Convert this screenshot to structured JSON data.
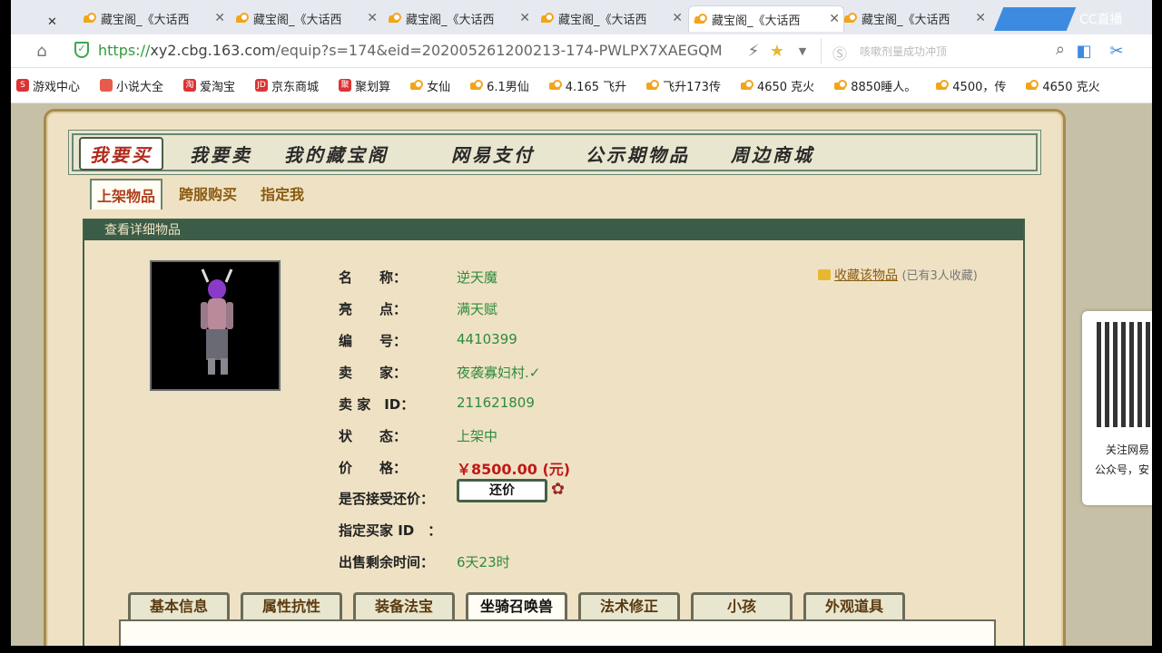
{
  "browser": {
    "tabs": [
      {
        "title": "藏宝阁_《大话西",
        "active": false
      },
      {
        "title": "藏宝阁_《大话西",
        "active": false
      },
      {
        "title": "藏宝阁_《大话西",
        "active": false
      },
      {
        "title": "藏宝阁_《大话西",
        "active": false
      },
      {
        "title": "藏宝阁_《大话西",
        "active": true
      },
      {
        "title": "藏宝阁_《大话西",
        "active": false
      }
    ],
    "cc_label": "CC直播",
    "url_scheme": "https://",
    "url_host": "xy2.cbg.163.com",
    "url_path": "/equip?s=174&eid=202005261200213-174-PWLPX7XAEGQM",
    "search_hint": "咳嗽剂量成功冲顶",
    "bookmarks": [
      "游戏中心",
      "小说大全",
      "爱淘宝",
      "京东商城",
      "聚划算",
      "女仙",
      "6.1男仙",
      "4.165 飞升",
      "飞升173传",
      "4650 克火",
      "8850睡人。",
      "4500，传",
      "4650 克火"
    ]
  },
  "site": {
    "nav": [
      "我要买",
      "我要卖",
      "我的藏宝阁",
      "网易支付",
      "公示期物品",
      "周边商城"
    ],
    "subnav": [
      "上架物品",
      "跨服购买",
      "指定我"
    ],
    "detail_title": "查看详细物品",
    "fields": [
      {
        "label": "名　　称：",
        "value": "逆天魔"
      },
      {
        "label": "亮　　点：",
        "value": "满天赋"
      },
      {
        "label": "编　　号：",
        "value": "4410399"
      },
      {
        "label": "卖　　家：",
        "value": "夜袭寡妇村.✓"
      },
      {
        "label": "卖 家　ID：",
        "value": "211621809"
      },
      {
        "label": "状　　态：",
        "value": "上架中"
      },
      {
        "label": "价　　格：",
        "value": "￥8500.00 (元)"
      },
      {
        "label": "是否接受还价：",
        "value": ""
      },
      {
        "label": "指定买家 ID　：",
        "value": ""
      },
      {
        "label": "出售剩余时间：",
        "value": "6天23时"
      }
    ],
    "counter_offer_button": "还价",
    "favorite_link": "收藏该物品",
    "favorite_count": "(已有3人收藏)",
    "info_tabs": [
      "基本信息",
      "属性抗性",
      "装备法宝",
      "坐骑召唤兽",
      "法术修正",
      "小孩",
      "外观道具"
    ],
    "info_tab_active": "坐骑召唤兽"
  },
  "qr_widget": {
    "line1": "关注网易",
    "line2": "公众号，安"
  }
}
